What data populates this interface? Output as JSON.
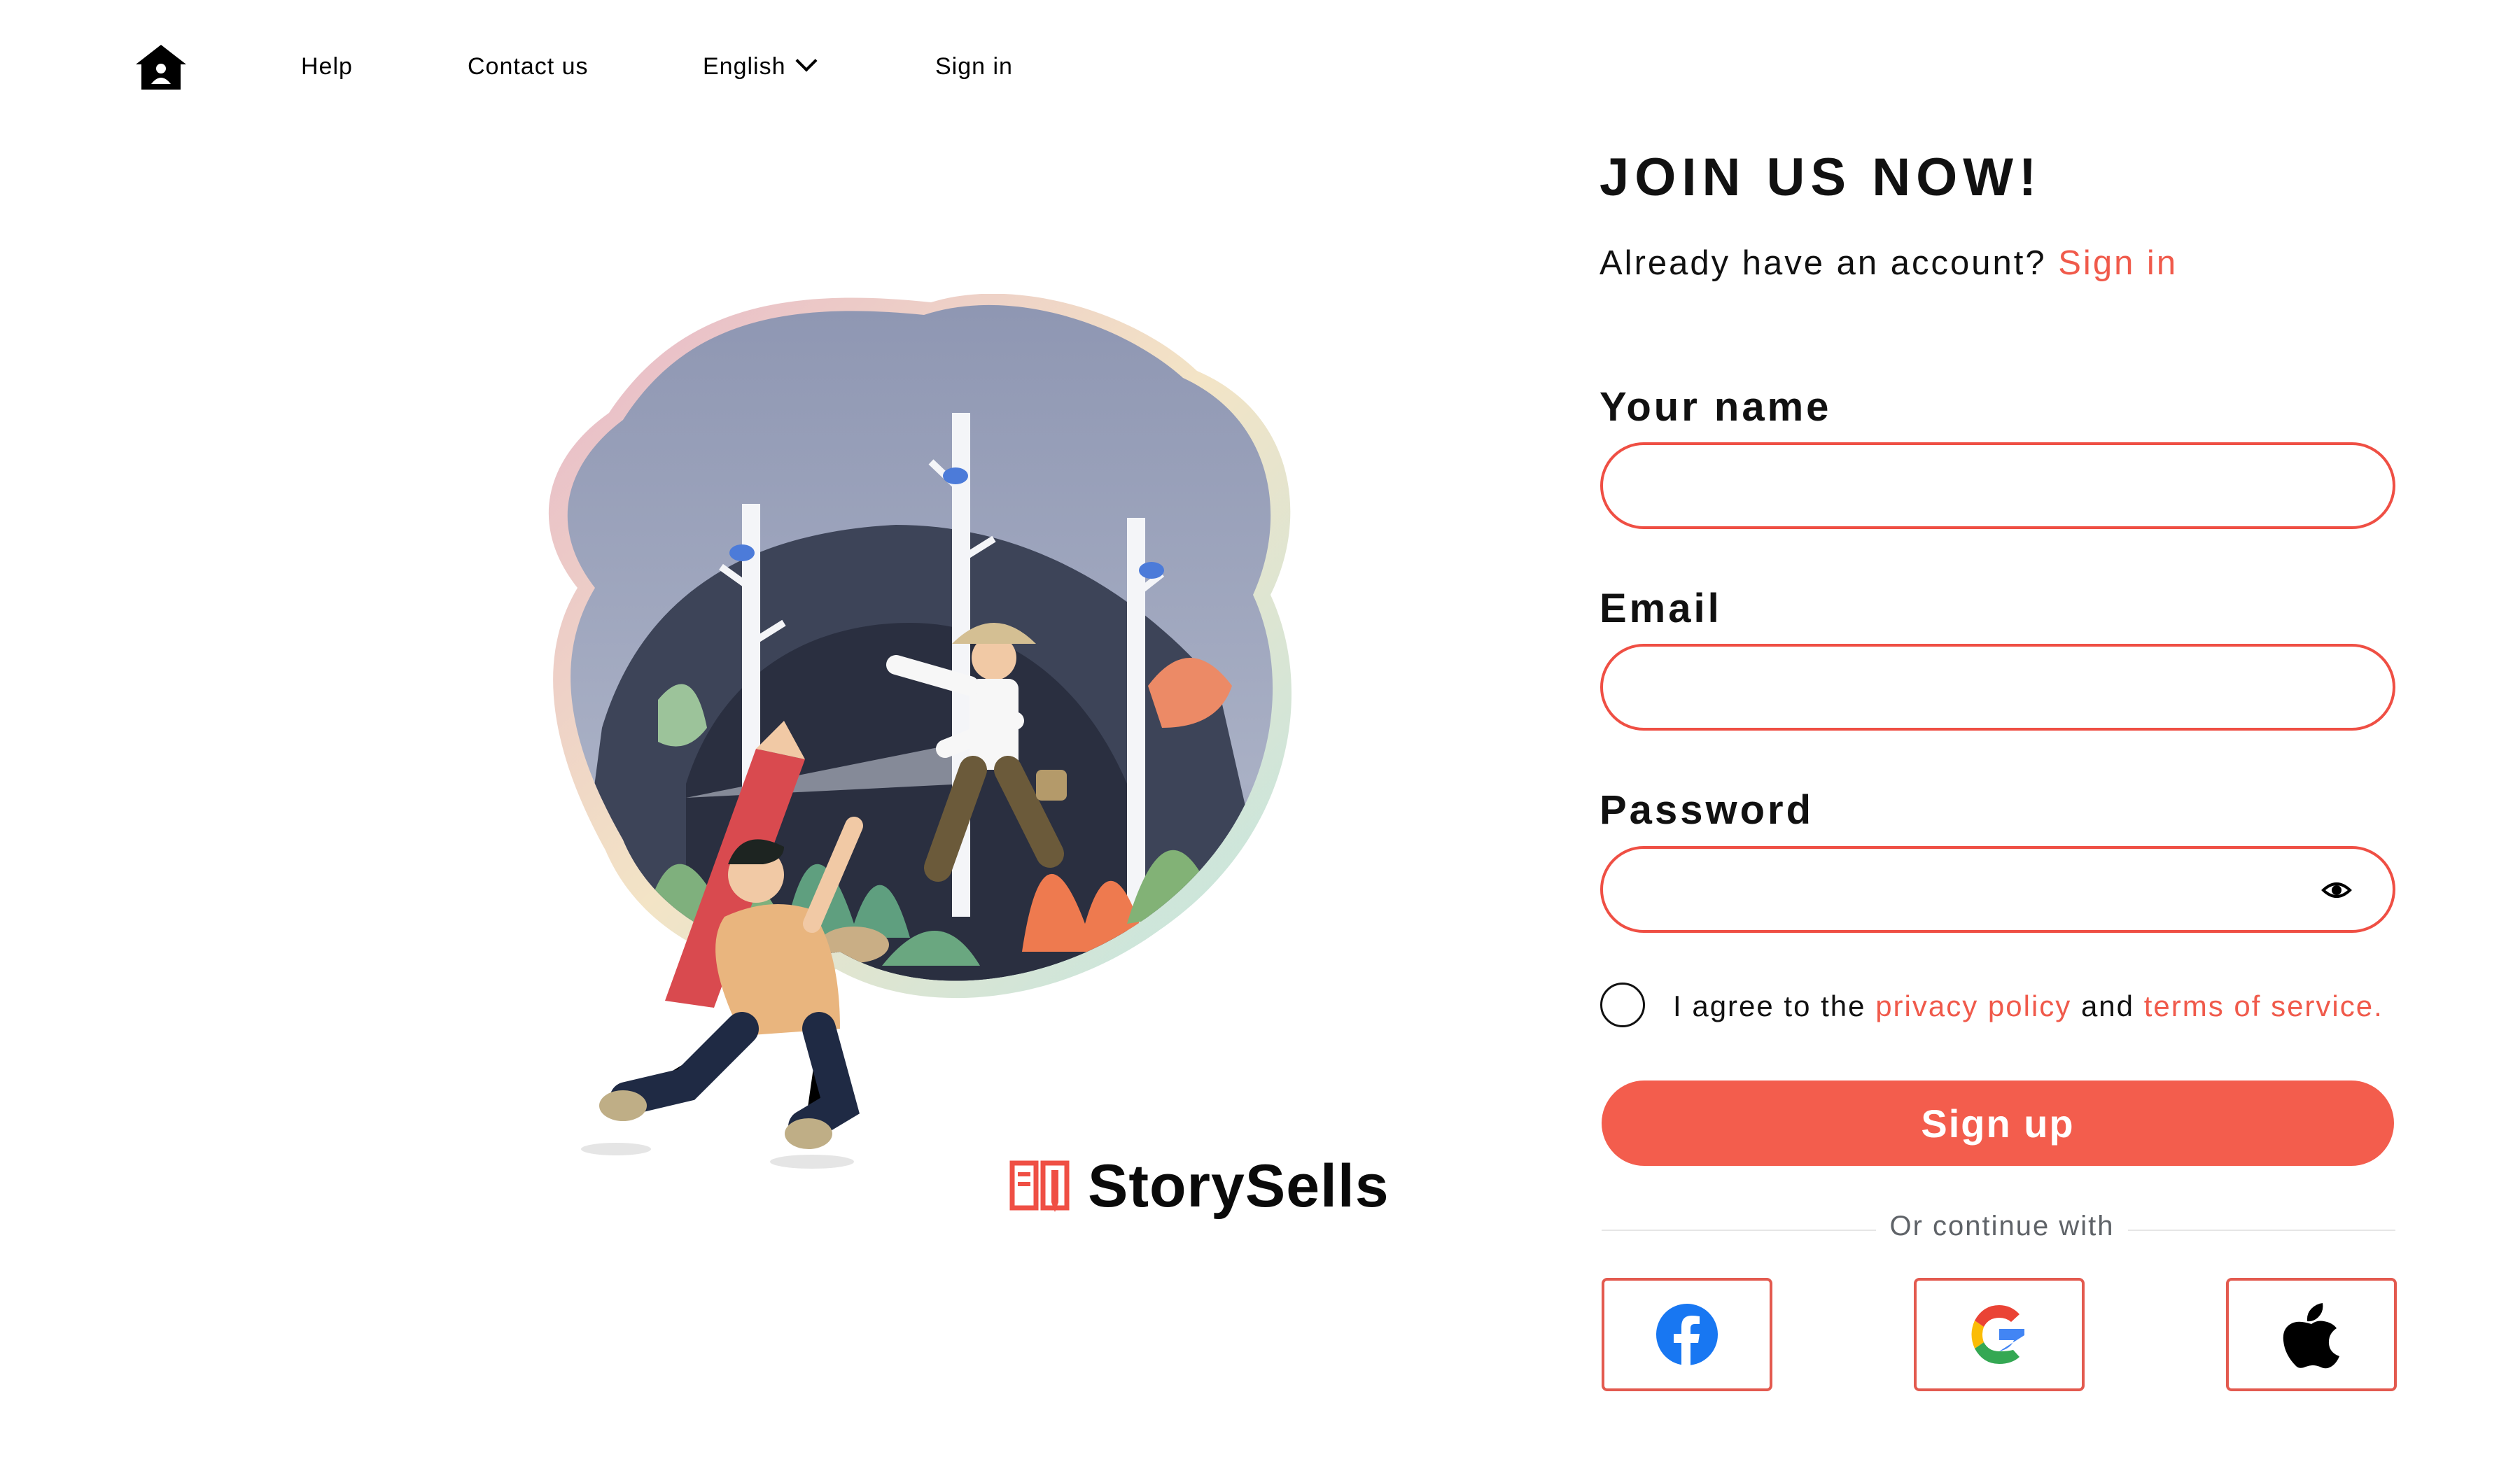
{
  "nav": {
    "help": "Help",
    "contact": "Contact us",
    "language": "English",
    "signin": "Sign in"
  },
  "brand": {
    "name": "StorySells"
  },
  "form": {
    "title": "JOIN US NOW!",
    "already": "Already have an account?",
    "signin_link": "Sign in",
    "name_label": "Your name",
    "email_label": "Email",
    "password_label": "Password",
    "name_value": "",
    "email_value": "",
    "password_value": "",
    "agree_prefix": "I agree to the",
    "privacy": "privacy policy",
    "and": "and",
    "terms": "terms of service.",
    "signup": "Sign up",
    "continue_with": "Or continue with"
  },
  "social": [
    "facebook-icon",
    "google-icon",
    "apple-icon"
  ],
  "colors": {
    "accent": "#f05a4b",
    "button": "#f35d4d",
    "facebook": "#1877f2"
  }
}
